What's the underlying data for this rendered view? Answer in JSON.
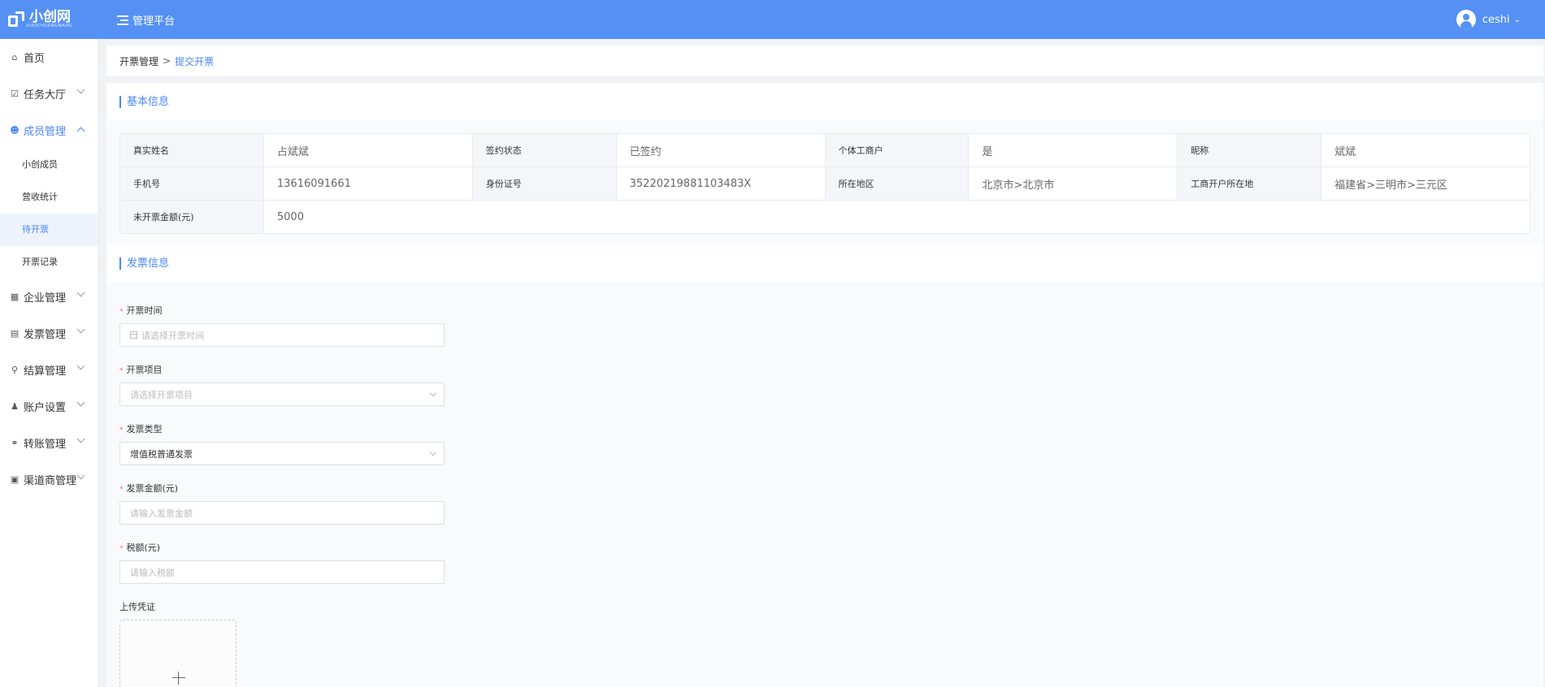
{
  "header": {
    "logo_text": "小创网",
    "logo_sub": "XIAOCHUANGWANG",
    "platform": "管理平台",
    "username": "ceshi",
    "bg_color": "#5591f5"
  },
  "sidebar": {
    "items": [
      {
        "label": "首页",
        "icon": "home-icon"
      },
      {
        "label": "任务大厅",
        "icon": "task-icon"
      },
      {
        "label": "成员管理",
        "icon": "members-icon"
      },
      {
        "label": "企业管理",
        "icon": "building-icon"
      },
      {
        "label": "发票管理",
        "icon": "invoice-icon"
      },
      {
        "label": "结算管理",
        "icon": "settlement-icon"
      },
      {
        "label": "账户设置",
        "icon": "account-icon"
      },
      {
        "label": "转账管理",
        "icon": "transfer-icon"
      },
      {
        "label": "渠道商管理",
        "icon": "channel-icon"
      }
    ],
    "sub_items": [
      "小创成员",
      "营收统计",
      "待开票",
      "开票记录"
    ],
    "active_sub": "待开票"
  },
  "breadcrumb": {
    "parent": "开票管理",
    "sep": ">",
    "current": "提交开票"
  },
  "basic_info": {
    "title": "基本信息",
    "rows": [
      [
        {
          "label": "真实姓名",
          "value": "占斌斌"
        },
        {
          "label": "签约状态",
          "value": "已签约"
        },
        {
          "label": "个体工商户",
          "value": "是"
        },
        {
          "label": "昵称",
          "value": "斌斌"
        }
      ],
      [
        {
          "label": "手机号",
          "value": "13616091661"
        },
        {
          "label": "身份证号",
          "value": "35220219881103483X"
        },
        {
          "label": "所在地区",
          "value": "北京市>北京市"
        },
        {
          "label": "工商开户所在地",
          "value": "福建省>三明市>三元区"
        }
      ]
    ],
    "uninvoiced": {
      "label": "未开票金额(元)",
      "value": "5000"
    }
  },
  "invoice_info": {
    "title": "发票信息",
    "fields": [
      {
        "label": "开票时间",
        "placeholder": "请选择开票时间",
        "required": "*"
      },
      {
        "label": "开票项目",
        "placeholder": "请选择开票项目",
        "required": "*"
      },
      {
        "label": "发票类型",
        "value": "增值税普通发票",
        "required": "*"
      },
      {
        "label": "发票金额(元)",
        "placeholder": "请输入发票金额",
        "required": "*"
      },
      {
        "label": "税额(元)",
        "placeholder": "请输入税额",
        "required": "*"
      }
    ],
    "upload_label": "上传凭证"
  }
}
